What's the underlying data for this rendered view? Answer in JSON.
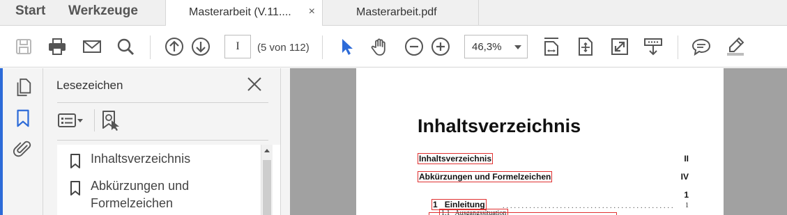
{
  "top_nav": {
    "start": "Start",
    "tools": "Werkzeuge"
  },
  "tabs": [
    {
      "label": "Masterarbeit (V.11....",
      "close": "×",
      "active": true
    },
    {
      "label": "Masterarbeit.pdf",
      "active": false
    }
  ],
  "toolbar": {
    "page_number": "I",
    "page_count": "(5 von 112)",
    "zoom": "46,3%",
    "icons": [
      "save-icon",
      "print-icon",
      "email-icon",
      "search-icon",
      "previous-page-icon",
      "next-page-icon",
      "select-cursor-icon",
      "hand-tool-icon",
      "zoom-out-icon",
      "zoom-in-icon",
      "scroll-mode-icon",
      "fit-page-icon",
      "full-screen-icon",
      "read-mode-icon",
      "comment-icon",
      "highlight-icon"
    ]
  },
  "rail": {
    "icons": [
      "page-thumbnails-icon",
      "bookmark-icon",
      "attachment-icon"
    ]
  },
  "bookmarks_panel": {
    "title": "Lesezeichen",
    "items": [
      {
        "label": "Inhaltsverzeichnis"
      },
      {
        "label": "Abkürzungen und Formelzeichen"
      }
    ]
  },
  "document": {
    "heading": "Inhaltsverzeichnis",
    "entries": [
      {
        "title": "Inhaltsverzeichnis",
        "page": "II"
      },
      {
        "title": "Abkürzungen und Formelzeichen",
        "page": "IV"
      },
      {
        "title": "1   Einleitung",
        "page": "1"
      }
    ],
    "subentry": {
      "title": "1.1   Ausgangssituation",
      "page": "1"
    }
  },
  "colors": {
    "accent": "#2d6bd8",
    "link_box": "#e03030",
    "doc_background": "#a1a1a1"
  }
}
